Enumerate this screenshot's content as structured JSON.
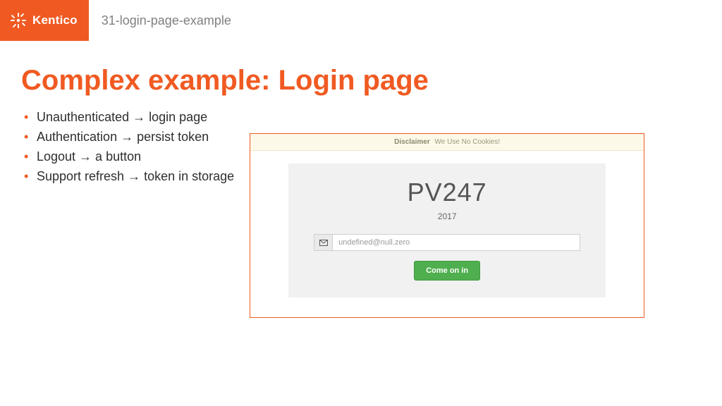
{
  "header": {
    "brand": "Kentico",
    "breadcrumb": "31-login-page-example"
  },
  "slide": {
    "title": "Complex example: Login page",
    "bullets": [
      "Unauthenticated → login page",
      "Authentication → persist token",
      "Logout → a button",
      "Support refresh → token in storage"
    ]
  },
  "screenshot": {
    "disclaimer_label": "Disclaimer",
    "disclaimer_text": "We Use No Cookies!",
    "login_title": "PV247",
    "login_subtitle": "2017",
    "email_value": "undefined@null.zero",
    "button_label": "Come on in"
  }
}
